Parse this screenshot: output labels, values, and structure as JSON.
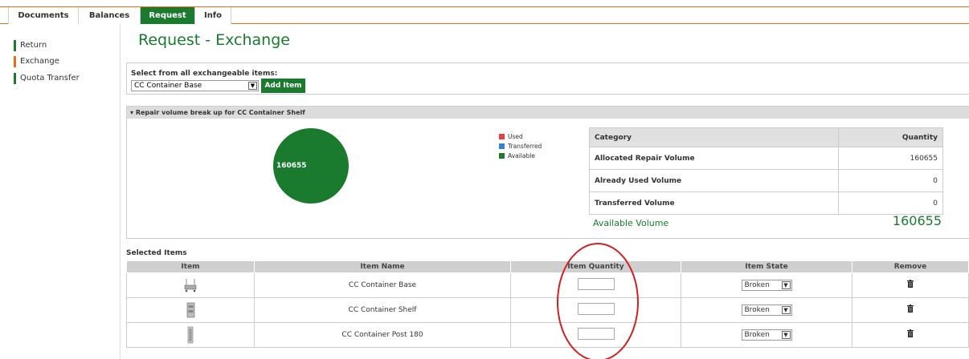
{
  "tabs": [
    {
      "label": "Documents",
      "active": false
    },
    {
      "label": "Balances",
      "active": false
    },
    {
      "label": "Request",
      "active": true
    },
    {
      "label": "Info",
      "active": false
    }
  ],
  "sidebar": {
    "items": [
      {
        "label": "Return",
        "active": false
      },
      {
        "label": "Exchange",
        "active": true
      },
      {
        "label": "Quota Transfer",
        "active": false
      }
    ]
  },
  "page": {
    "title": "Request - Exchange"
  },
  "selector": {
    "label": "Select from all exchangeable items:",
    "selected": "CC Container Base",
    "add_button": "Add Item"
  },
  "repair": {
    "header": "Repair volume break up for CC Container Shelf",
    "pie_label": "160655",
    "legend": [
      {
        "label": "Used",
        "color": "#e84040"
      },
      {
        "label": "Transferred",
        "color": "#3a7fd6"
      },
      {
        "label": "Available",
        "color": "#1a7a2e"
      }
    ],
    "columns": {
      "category": "Category",
      "quantity": "Quantity"
    },
    "rows": [
      {
        "category": "Allocated Repair Volume",
        "quantity": "160655"
      },
      {
        "category": "Already Used Volume",
        "quantity": "0"
      },
      {
        "category": "Transferred Volume",
        "quantity": "0"
      }
    ],
    "available_label": "Available Volume",
    "available_value": "160655"
  },
  "selected_items": {
    "title": "Selected Items",
    "columns": {
      "item": "Item",
      "name": "Item Name",
      "quantity": "Item Quantity",
      "state": "Item State",
      "remove": "Remove"
    },
    "rows": [
      {
        "name": "CC Container Base",
        "quantity": "",
        "state": "Broken"
      },
      {
        "name": "CC Container Shelf",
        "quantity": "",
        "state": "Broken"
      },
      {
        "name": "CC Container Post 180",
        "quantity": "",
        "state": "Broken"
      }
    ]
  },
  "colors": {
    "brand_green": "#1a7a2e",
    "accent_orange": "#e07020",
    "annotation_red": "#cc2222"
  }
}
